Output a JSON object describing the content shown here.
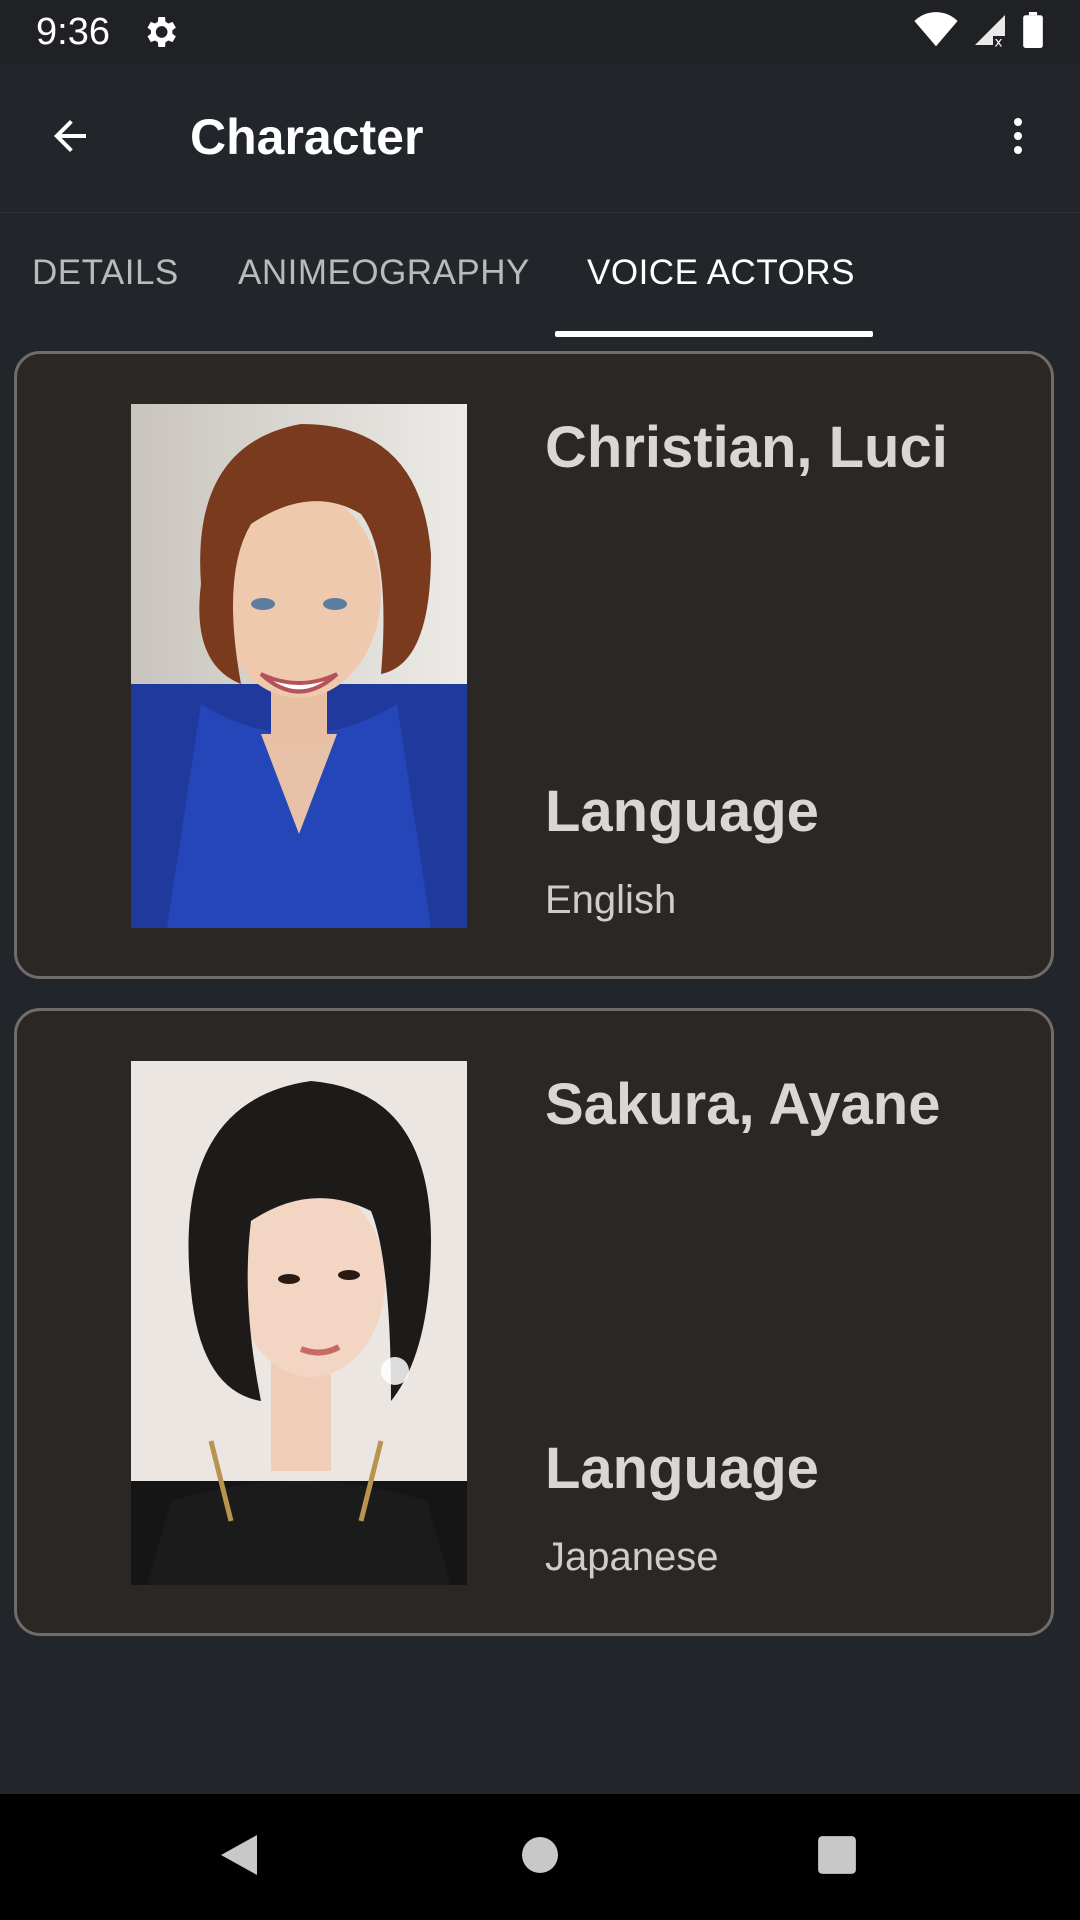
{
  "status_bar": {
    "time": "9:36",
    "icons": [
      "gear-icon",
      "wifi-icon",
      "signal-icon",
      "battery-icon"
    ]
  },
  "app_bar": {
    "title": "Character",
    "back_icon": "arrow-left-icon",
    "menu_icon": "more-vert-icon"
  },
  "tabs": [
    {
      "label": "DETAILS",
      "active": false
    },
    {
      "label": "ANIMEOGRAPHY",
      "active": false
    },
    {
      "label": "VOICE ACTORS",
      "active": true
    }
  ],
  "voice_actors": [
    {
      "name": "Christian, Luci",
      "language_label": "Language",
      "language": "English"
    },
    {
      "name": "Sakura, Ayane",
      "language_label": "Language",
      "language": "Japanese"
    }
  ],
  "colors": {
    "background": "#22252a",
    "card": "#2b2725",
    "card_border": "#6f6c6a",
    "active_tab": "#ffffff"
  },
  "nav_bar": {
    "icons": [
      "back-triangle-icon",
      "home-circle-icon",
      "recents-square-icon"
    ]
  }
}
